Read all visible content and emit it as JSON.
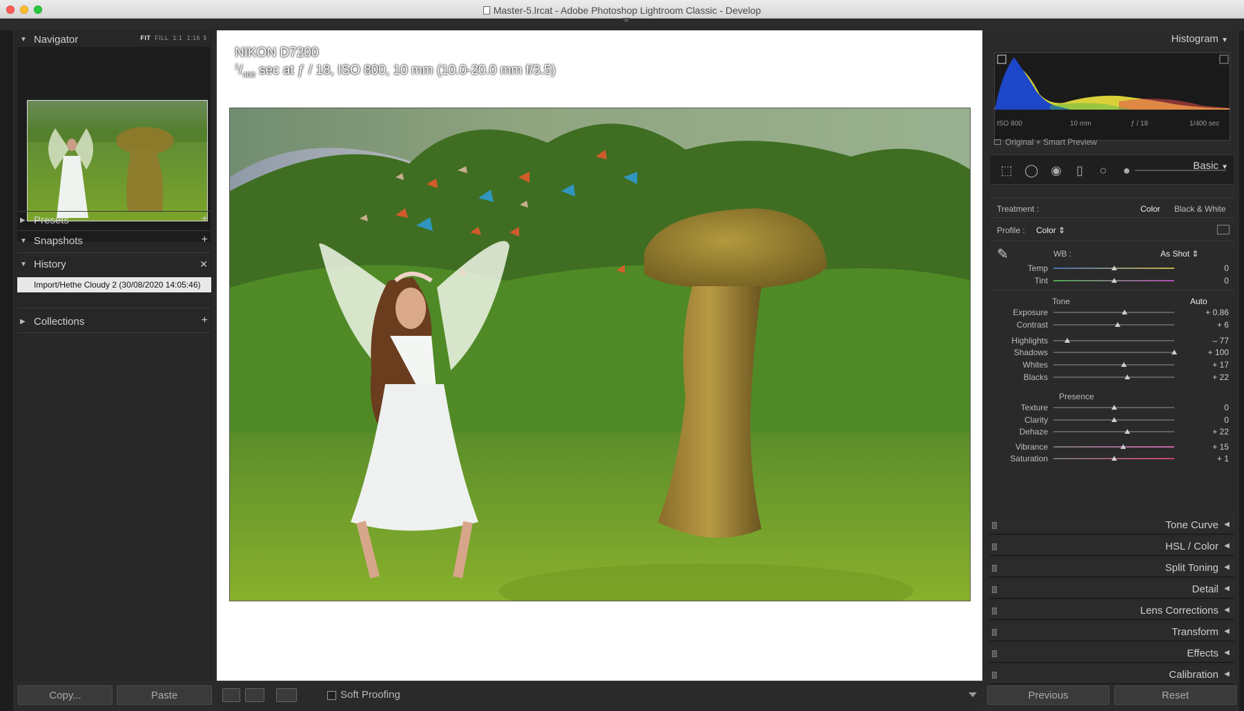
{
  "window": {
    "title": "Master-5.lrcat - Adobe Photoshop Lightroom Classic - Develop"
  },
  "left": {
    "navigator": {
      "label": "Navigator",
      "opts": [
        "FIT",
        "FILL",
        "1:1",
        "1:16 ⇕"
      ]
    },
    "presets": {
      "label": "Presets"
    },
    "snapshots": {
      "label": "Snapshots"
    },
    "history": {
      "label": "History",
      "entry": "Import/Hethe Cloudy 2 (30/08/2020 14:05:46)"
    },
    "collections": {
      "label": "Collections"
    },
    "copy": "Copy...",
    "paste": "Paste"
  },
  "center": {
    "camera": "NIKON D7200",
    "shutter_num": "1",
    "shutter_den": "400",
    "exposure_rest": " sec at ƒ / 18, ISO 800, 10 mm (10.0-20.0 mm f/3.5)"
  },
  "toolbar": {
    "soft_proofing": "Soft Proofing"
  },
  "right": {
    "histogram": {
      "label": "Histogram",
      "iso": "ISO 800",
      "focal": "10 mm",
      "aperture": "ƒ / 18",
      "shutter": "1/400 sec",
      "smart_preview": "Original + Smart Preview"
    },
    "basic": {
      "label": "Basic",
      "treatment_label": "Treatment :",
      "treatment_color": "Color",
      "treatment_bw": "Black & White",
      "profile_label": "Profile :",
      "profile_value": "Color ⇕",
      "wb_label": "WB :",
      "wb_value": "As Shot ⇕",
      "tone_label": "Tone",
      "auto": "Auto",
      "presence_label": "Presence",
      "sliders": [
        {
          "label": "Temp",
          "value": "0",
          "pos": 0.5
        },
        {
          "label": "Tint",
          "value": "0",
          "pos": 0.5
        },
        {
          "label": "Exposure",
          "value": "+ 0.86",
          "pos": 0.586
        },
        {
          "label": "Contrast",
          "value": "+ 6",
          "pos": 0.53
        },
        {
          "label": "Highlights",
          "value": "– 77",
          "pos": 0.115
        },
        {
          "label": "Shadows",
          "value": "+ 100",
          "pos": 1.0
        },
        {
          "label": "Whites",
          "value": "+ 17",
          "pos": 0.585
        },
        {
          "label": "Blacks",
          "value": "+ 22",
          "pos": 0.61
        },
        {
          "label": "Texture",
          "value": "0",
          "pos": 0.5
        },
        {
          "label": "Clarity",
          "value": "0",
          "pos": 0.5
        },
        {
          "label": "Dehaze",
          "value": "+ 22",
          "pos": 0.61
        },
        {
          "label": "Vibrance",
          "value": "+ 15",
          "pos": 0.575
        },
        {
          "label": "Saturation",
          "value": "+ 1",
          "pos": 0.505
        }
      ]
    },
    "sections": [
      "Tone Curve",
      "HSL / Color",
      "Split Toning",
      "Detail",
      "Lens Corrections",
      "Transform",
      "Effects",
      "Calibration"
    ],
    "previous": "Previous",
    "reset": "Reset"
  }
}
